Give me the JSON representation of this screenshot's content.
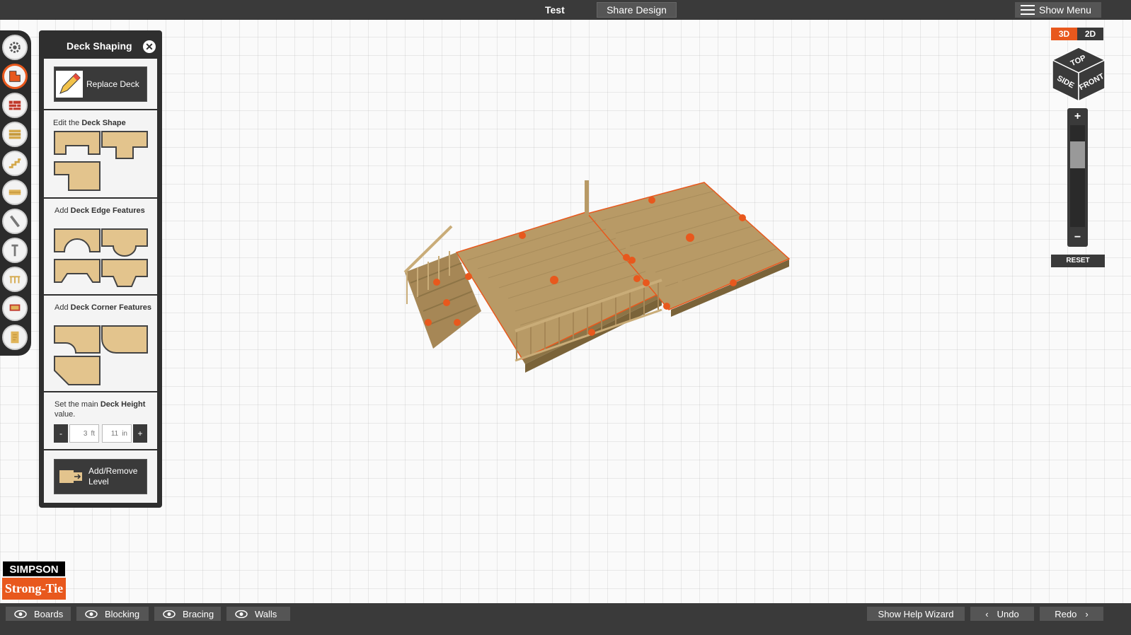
{
  "header": {
    "project_title": "Test",
    "share_label": "Share Design",
    "menu_label": "Show Menu"
  },
  "tool_rail": {
    "tools": [
      "settings-icon",
      "deck-shape-icon",
      "brick-icon",
      "boards-icon",
      "stairs-icon",
      "lumber-icon",
      "connector-icon",
      "fastener-icon",
      "railing-icon",
      "bench-icon",
      "report-icon"
    ],
    "active_index": 1
  },
  "panel": {
    "title": "Deck Shaping",
    "replace_deck_label": "Replace Deck",
    "edit_shape": {
      "prefix": "Edit the ",
      "bold": "Deck Shape"
    },
    "edge_features": {
      "prefix": "Add ",
      "bold": "Deck Edge Features"
    },
    "corner_features": {
      "prefix": "Add ",
      "bold": "Deck Corner Features"
    },
    "height": {
      "prefix": "Set the main ",
      "bold": "Deck Height",
      "suffix": " value."
    },
    "height_minus": "-",
    "height_plus": "+",
    "height_ft_value": "3",
    "height_ft_unit": "ft",
    "height_in_value": "11",
    "height_in_unit": "in",
    "level_label": "Add/Remove Level"
  },
  "view_controls": {
    "mode_3d": "3D",
    "mode_2d": "2D",
    "active_mode": "3D",
    "cube_top": "TOP",
    "cube_side": "SIDE",
    "cube_front": "FRONT",
    "zoom_in": "+",
    "zoom_out": "−",
    "reset_label": "RESET"
  },
  "logo": {
    "line1": "SIMPSON",
    "line2": "Strong-Tie"
  },
  "footer": {
    "toggles": [
      "Boards",
      "Blocking",
      "Bracing",
      "Walls"
    ],
    "help_label": "Show Help Wizard",
    "undo_label": "Undo",
    "redo_label": "Redo"
  },
  "colors": {
    "accent": "#e8581d",
    "dark": "#3a3a3a",
    "wood": "#b89a66",
    "shape_fill": "#e3c48d"
  }
}
